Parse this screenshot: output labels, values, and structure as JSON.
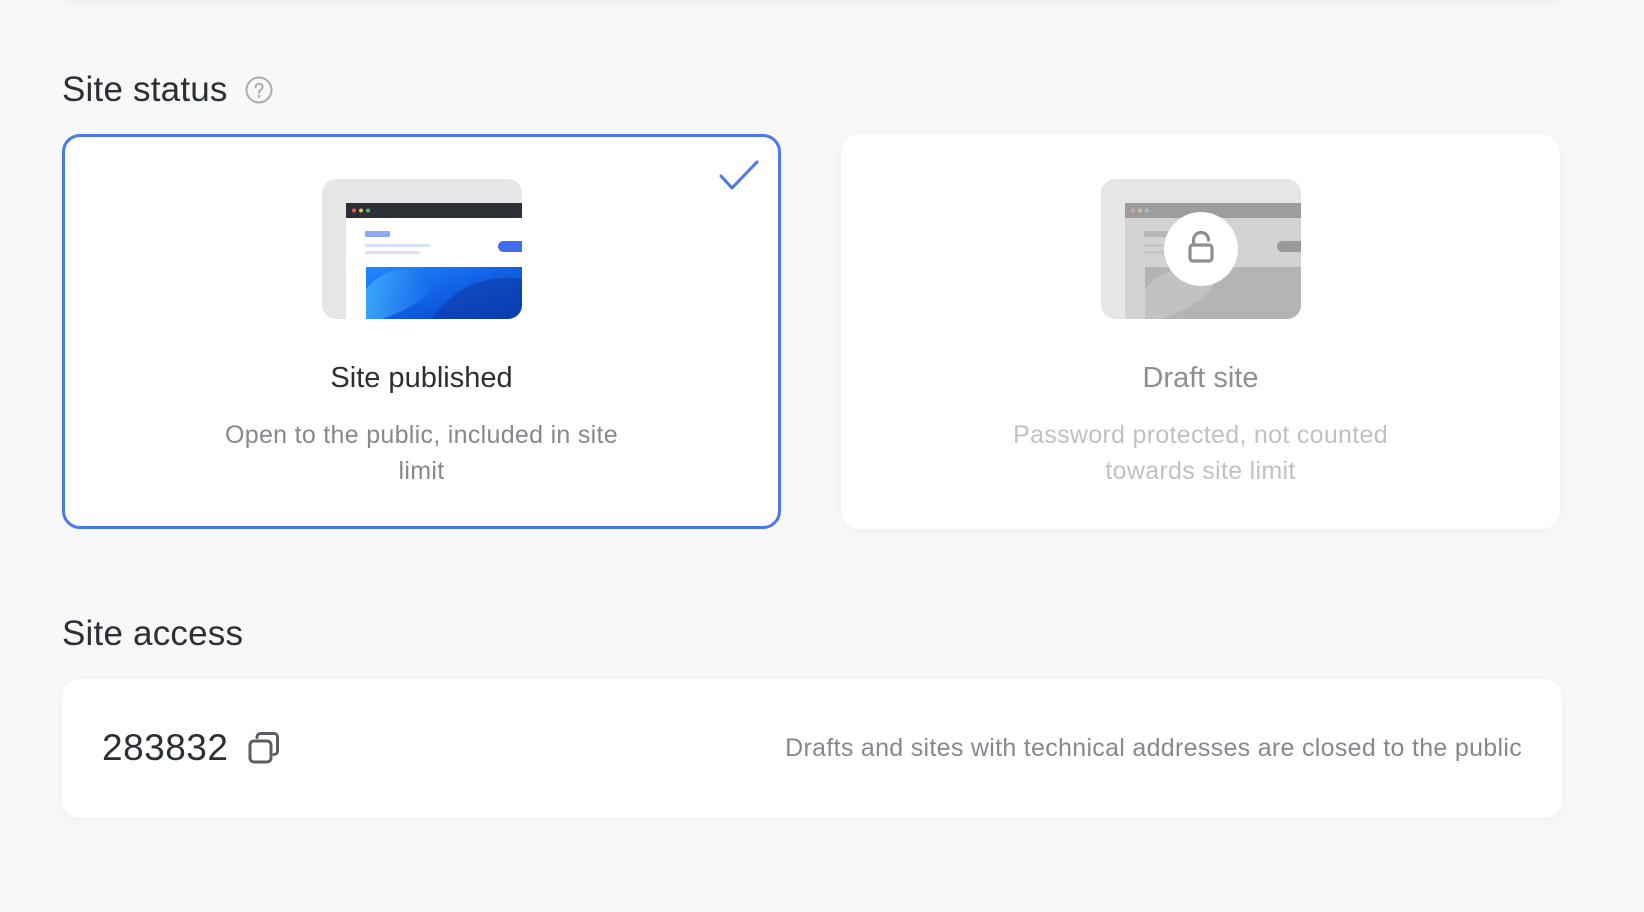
{
  "site_status": {
    "title": "Site status",
    "help_icon": "question-circle-icon",
    "options": [
      {
        "title": "Site published",
        "description": "Open to the public, included in site limit",
        "selected": true,
        "icon": "check-icon"
      },
      {
        "title": "Draft site",
        "description": "Password protected, not counted towards site limit",
        "selected": false,
        "icon": "lock-icon"
      }
    ]
  },
  "site_access": {
    "title": "Site access",
    "code": "283832",
    "copy_icon": "copy-icon",
    "note": "Drafts and sites with technical addresses are closed to the public"
  },
  "colors": {
    "accent": "#4a78f0",
    "background": "#f8f8f8",
    "card": "#ffffff"
  }
}
